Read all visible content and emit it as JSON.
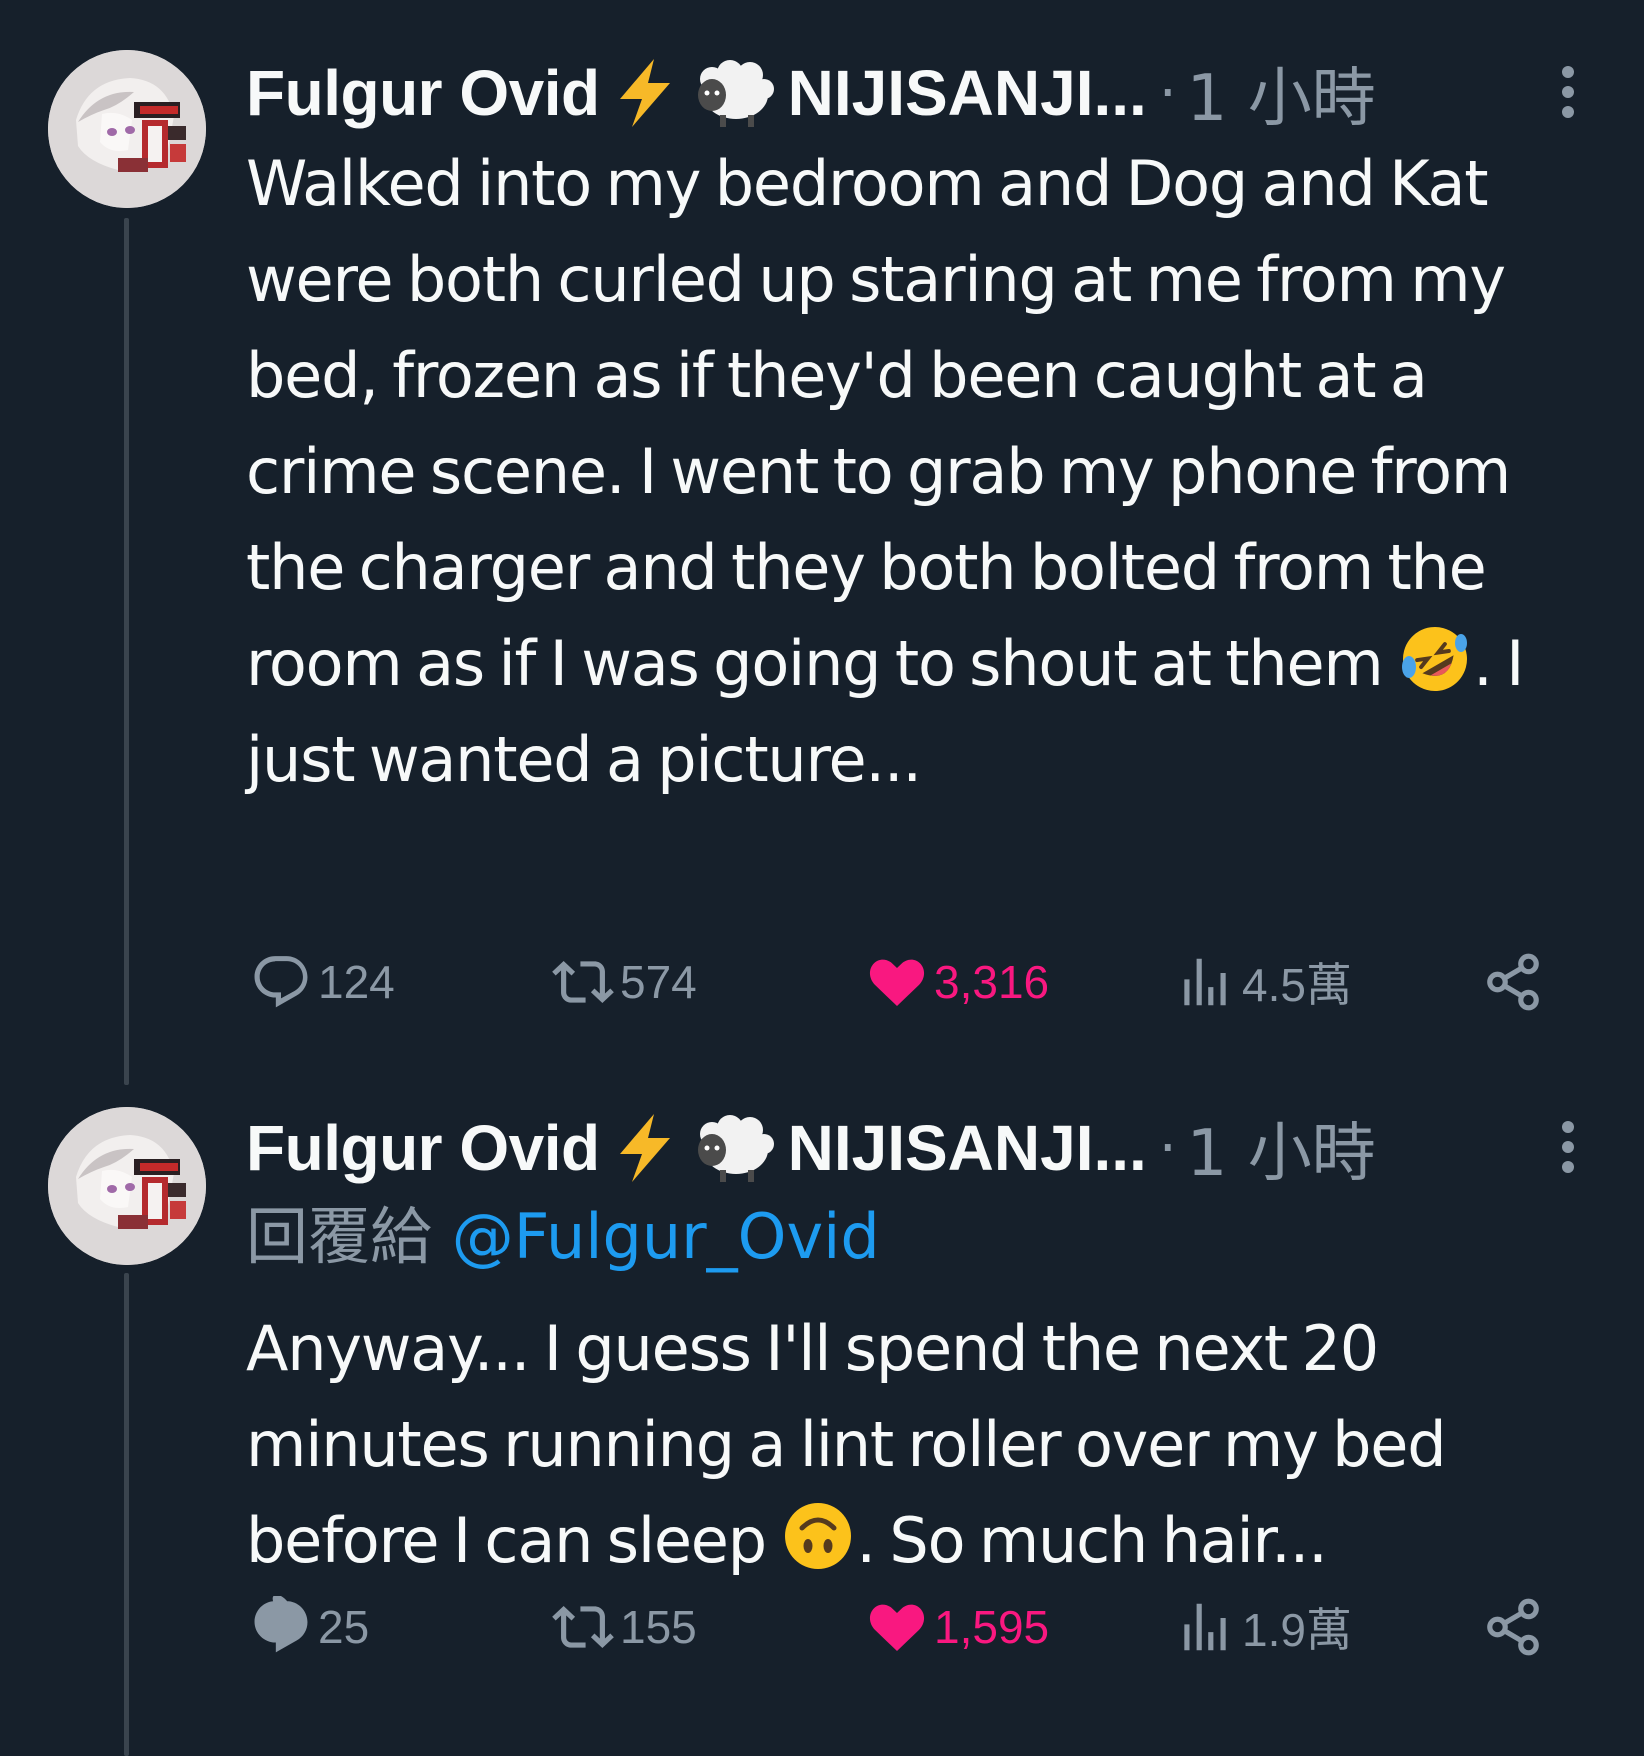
{
  "tweets": [
    {
      "author": "Fulgur Ovid",
      "org": "NIJISANJI...",
      "separator": "·",
      "time": "1 小時",
      "reply_prefix": "",
      "reply_handle": "",
      "text_before_emoji": "Walked into my bedroom and Dog and Kat were both curled up staring at me from my bed, frozen as if they'd been caught at a crime scene. I went to grab my phone from the charger and they both bolted from the room as if I was going to shout at them ",
      "text_after_emoji": ". I just wanted a picture...",
      "emoji": "rolling-on-floor-laughing-emoji",
      "replies": "124",
      "retweets": "574",
      "likes": "3,316",
      "views": "4.5萬"
    },
    {
      "author": "Fulgur Ovid",
      "org": "NIJISANJI...",
      "separator": "·",
      "time": "1 小時",
      "reply_prefix": "回覆給",
      "reply_handle": "@Fulgur_Ovid",
      "text_before_emoji": "Anyway... I guess I'll spend the next 20 minutes running a lint roller over my bed before I can sleep ",
      "text_after_emoji": ". So much hair...",
      "emoji": "upside-down-face-emoji",
      "replies": "25",
      "retweets": "155",
      "likes": "1,595",
      "views": "1.9萬"
    }
  ],
  "colors": {
    "background": "#16202b",
    "text": "#f7f9f9",
    "muted": "#8b98a5",
    "like": "#f91880",
    "link": "#1d9bf0",
    "thread_line": "#3a444e"
  },
  "icons": [
    "lightning-emoji",
    "sheep-emoji",
    "more-icon",
    "reply-icon",
    "retweet-icon",
    "heart-icon",
    "views-icon",
    "share-icon"
  ]
}
